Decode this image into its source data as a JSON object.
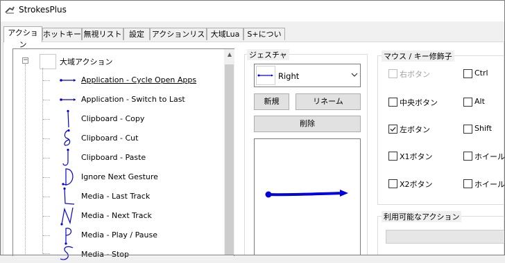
{
  "window": {
    "title": "StrokesPlus"
  },
  "tabs": [
    {
      "label": "アクション"
    },
    {
      "label": "ホットキー"
    },
    {
      "label": "無視リスト"
    },
    {
      "label": "設定"
    },
    {
      "label": "アクションリスト"
    },
    {
      "label": "大域Lua"
    },
    {
      "label": "S+について"
    }
  ],
  "tree": {
    "root_label": "大域アクション",
    "collapse_glyph": "−",
    "items": [
      {
        "label": "Application - Cycle Open Apps",
        "gesture": "right-arrow"
      },
      {
        "label": "Application - Switch to Last",
        "gesture": "right-arrow"
      },
      {
        "label": "Clipboard - Copy",
        "gesture": "down-line"
      },
      {
        "label": "Clipboard - Cut",
        "gesture": "loop"
      },
      {
        "label": "Clipboard - Paste",
        "gesture": "down-curl"
      },
      {
        "label": "Ignore Next Gesture",
        "gesture": "D-shape"
      },
      {
        "label": "Media - Last Track",
        "gesture": "L-shape"
      },
      {
        "label": "Media - Next Track",
        "gesture": "N-shape"
      },
      {
        "label": "Media - Play / Pause",
        "gesture": "P-shape"
      },
      {
        "label": "Media - Stop",
        "gesture": "S-shape"
      }
    ]
  },
  "gesture_panel": {
    "title": "ジェスチャ",
    "selected": "Right",
    "new_button": "新規",
    "rename_button": "リネーム",
    "delete_button": "削除"
  },
  "modifiers": {
    "title": "マウス / キー修飾子",
    "left_column": [
      {
        "label": "右ボタン",
        "checked": false,
        "disabled": true
      },
      {
        "label": "中央ボタン",
        "checked": false,
        "disabled": false
      },
      {
        "label": "左ボタン",
        "checked": true,
        "disabled": false
      },
      {
        "label": "X1ボタン",
        "checked": false,
        "disabled": false
      },
      {
        "label": "X2ボタン",
        "checked": false,
        "disabled": false
      }
    ],
    "right_column": [
      {
        "label": "Ctrl",
        "checked": false
      },
      {
        "label": "Alt",
        "checked": false
      },
      {
        "label": "Shift",
        "checked": false
      },
      {
        "label": "ホイール上",
        "checked": false
      },
      {
        "label": "ホイール下",
        "checked": false
      }
    ]
  },
  "available_actions": {
    "title": "利用可能なアクション"
  },
  "colors": {
    "stroke": "#0000e0",
    "check": "#333333"
  }
}
